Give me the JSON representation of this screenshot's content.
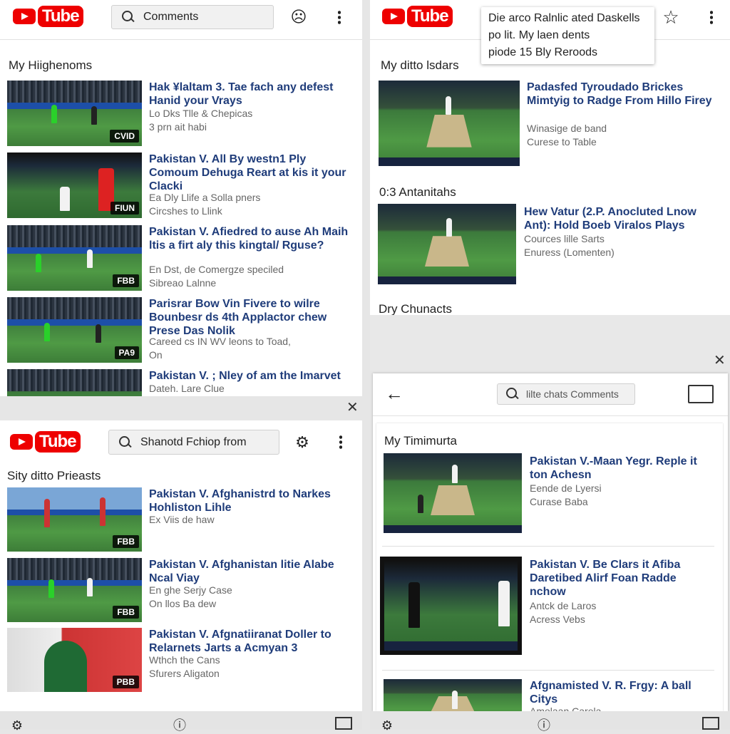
{
  "brand": {
    "logo_text": "Tube",
    "colors": {
      "brand_red": "#ee0000",
      "title_blue": "#1f3c7a"
    }
  },
  "panel_tl": {
    "search_value": "Comments",
    "section": "My Hiighenoms",
    "items": [
      {
        "title": "Hak ¥laltam 3. Tae fach any defest Hanid your Vrays",
        "meta1": "Lo Dks Tlle & Chepicas",
        "meta2": "3 prn ait habi",
        "badge": "CVID"
      },
      {
        "title": "Pakistan V. All By westn1 Ply Comoum Dehuga Reart at kis it your Clacki",
        "meta1": "Ea Dly Llife a Solla pners",
        "meta2": "Circshes to Llink",
        "badge": "FIUN"
      },
      {
        "title": "Pakistan V. Afiedred to ause Ah Maih ltis a firt aly this kingtal/ Rguse?",
        "meta1": "En Dst, de Comergze speciled",
        "meta2": "Sibreao Lalnne",
        "badge": "FBB"
      },
      {
        "title": "Parisrar Bow Vin Fivere to wilre Bounbesr ds 4th Applactor chew Prese Das Nolik",
        "meta1": "Careed cs IN WV leons to Toad,",
        "meta2": "On",
        "badge": "PA9"
      },
      {
        "title": "Pakistan V. ; Nley of am the Imarvet",
        "meta1": "Dateh. Lare Clue",
        "meta2": "",
        "badge": ""
      }
    ]
  },
  "panel_tr": {
    "tooltip": [
      "Die arco Ralnlic ated Daskells",
      "po lit. My laen dents",
      "piode 15 Bly Reroods"
    ],
    "section1": "My ditto lsdars",
    "items1": [
      {
        "title": "Padasfed Tyroudado Brickes Mimtyig to Radge From Hillo Firey",
        "meta1": "Winasige de band",
        "meta2": "Curese to Table"
      }
    ],
    "section2": "0:3 Antanitahs",
    "items2": [
      {
        "title": "Hew Vatur (2.P. Anocluted Lnow Ant): Hold Boeb Viralos Plays",
        "meta1": "Cources lille Sarts",
        "meta2": "Enuress (Lomenten)"
      }
    ],
    "section3": "Dry Chunacts"
  },
  "panel_bl": {
    "search_value": "Shanotd Fchiop from",
    "section": "Sity ditto Prieasts",
    "items": [
      {
        "title": "Pakistan V. Afghanistrd to Narkes Hohliston Lihle",
        "meta1": "Ex Viis de haw",
        "meta2": "",
        "badge": "FBB"
      },
      {
        "title": "Pakistan V. Afghanistan litie Alabe Ncal Viay",
        "meta1": "En ghe Serjy Case",
        "meta2": "On llos Ba dew",
        "badge": "FBB"
      },
      {
        "title": "Pakistan V. Afgnatiiranat Doller to Relarnets Jarts a Acmyan 3",
        "meta1": "Wthch the Cans",
        "meta2": "Sfurers Aligaton",
        "badge": "PBB"
      }
    ]
  },
  "panel_br": {
    "search_value": "lilte chats Comments",
    "section": "My Timimurta",
    "items": [
      {
        "title": "Pakistan V.-Maan Yegr. Reple it ton Achesn",
        "meta1": "Eende de Lyersi",
        "meta2": "Curase Baba"
      },
      {
        "title": "Pakistan V. Be Clars it Afiba Daretibed Alirf Foan Radde nchow",
        "meta1": "Antck de Laros",
        "meta2": "Acress Vebs"
      },
      {
        "title": "Afgnamisted V. R. Frgy: A ball Citys",
        "meta1": "Amolaan Carela",
        "meta2": ""
      }
    ]
  },
  "icons": [
    "search-icon",
    "account-icon",
    "more-vert-icon",
    "star-icon",
    "close-icon",
    "back-arrow-icon",
    "cast-icon",
    "settings-icon",
    "info-icon",
    "fullscreen-icon"
  ]
}
